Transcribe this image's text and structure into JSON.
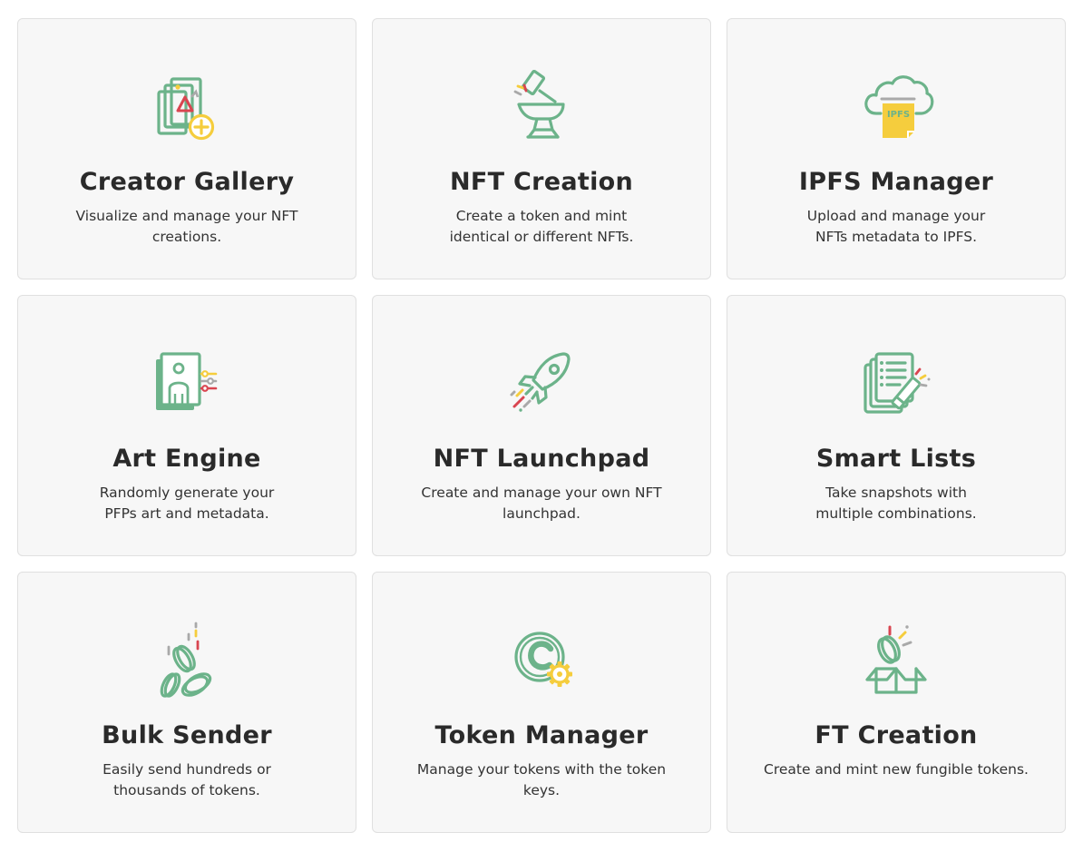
{
  "palette": {
    "green": "#6cb38a",
    "yellow": "#f5cd3d",
    "red": "#d94550",
    "grey": "#a9a9a9",
    "card_bg": "#f7f7f7",
    "card_border": "#e0e0e0"
  },
  "cards": [
    {
      "title": "Creator Gallery",
      "description": "Visualize and manage your NFT creations.",
      "icon": "gallery-add-icon"
    },
    {
      "title": "NFT Creation",
      "description": "Create a token and mint identical or different NFTs.",
      "icon": "anvil-hammer-icon"
    },
    {
      "title": "IPFS Manager",
      "description": "Upload and manage your NFTs metadata to IPFS.",
      "icon": "ipfs-cloud-icon"
    },
    {
      "title": "Art Engine",
      "description": "Randomly generate your PFPs art and metadata.",
      "icon": "profile-sliders-icon"
    },
    {
      "title": "NFT Launchpad",
      "description": "Create and manage your own NFT launchpad.",
      "icon": "rocket-icon"
    },
    {
      "title": "Smart Lists",
      "description": "Take snapshots with multiple combinations.",
      "icon": "list-pencil-icon"
    },
    {
      "title": "Bulk Sender",
      "description": "Easily send hundreds or thousands of tokens.",
      "icon": "coins-icon"
    },
    {
      "title": "Token Manager",
      "description": "Manage your tokens with the token keys.",
      "icon": "token-gear-icon"
    },
    {
      "title": "FT Creation",
      "description": "Create and mint new fungible tokens.",
      "icon": "coin-box-icon"
    }
  ]
}
